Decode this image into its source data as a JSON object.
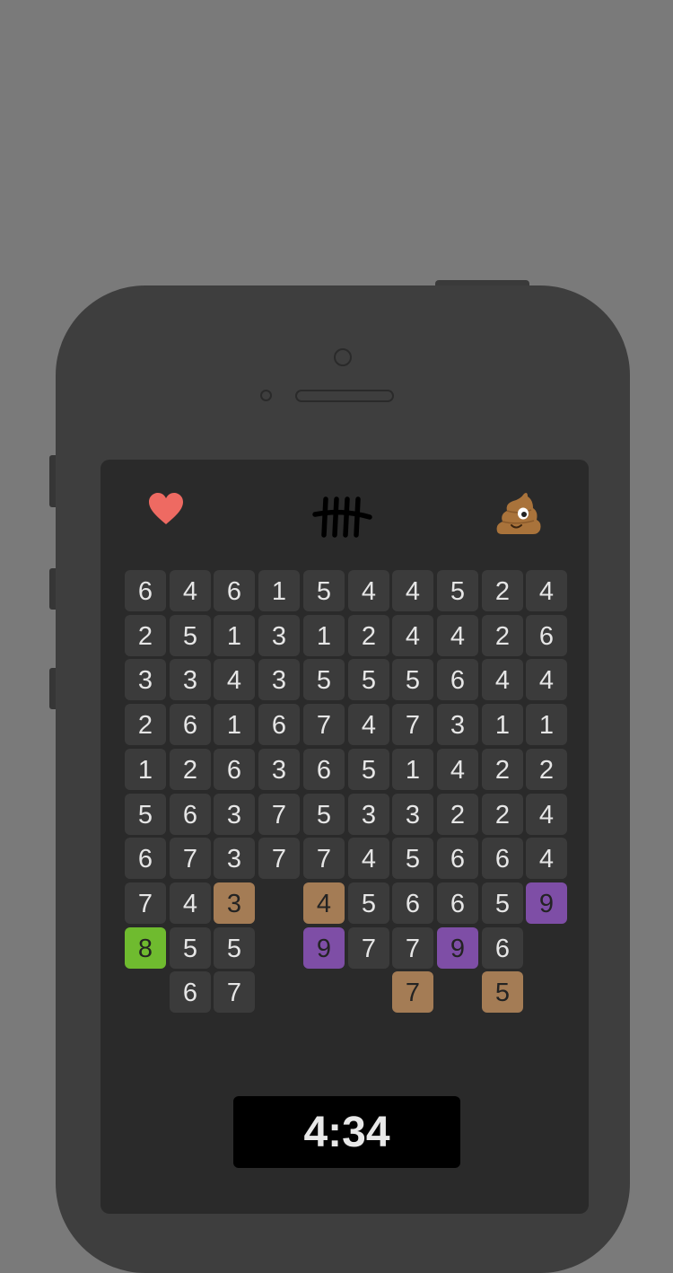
{
  "header": {
    "lives_icon": "heart-icon",
    "tally_icon": "tally-marks-icon",
    "score_tally_marks": 5,
    "poop_icon": "poop-emoji-icon"
  },
  "colors": {
    "background": "#7a7a7a",
    "phone_body": "#3e3e3e",
    "screen": "#2a2a2a",
    "tile_default": "#3b3b3b",
    "tile_tan": "#a47c55",
    "tile_purple": "#7e4ea6",
    "tile_green": "#6fbb2f",
    "heart": "#ee6a62",
    "timer_bg": "#000000"
  },
  "board": {
    "columns": 10,
    "rows": [
      [
        {
          "v": "6"
        },
        {
          "v": "4"
        },
        {
          "v": "6"
        },
        {
          "v": "1"
        },
        {
          "v": "5"
        },
        {
          "v": "4"
        },
        {
          "v": "4"
        },
        {
          "v": "5"
        },
        {
          "v": "2"
        },
        {
          "v": "4"
        }
      ],
      [
        {
          "v": "2"
        },
        {
          "v": "5"
        },
        {
          "v": "1"
        },
        {
          "v": "3"
        },
        {
          "v": "1"
        },
        {
          "v": "2"
        },
        {
          "v": "4"
        },
        {
          "v": "4"
        },
        {
          "v": "2"
        },
        {
          "v": "6"
        }
      ],
      [
        {
          "v": "3"
        },
        {
          "v": "3"
        },
        {
          "v": "4"
        },
        {
          "v": "3"
        },
        {
          "v": "5"
        },
        {
          "v": "5"
        },
        {
          "v": "5"
        },
        {
          "v": "6"
        },
        {
          "v": "4"
        },
        {
          "v": "4"
        }
      ],
      [
        {
          "v": "2"
        },
        {
          "v": "6"
        },
        {
          "v": "1"
        },
        {
          "v": "6"
        },
        {
          "v": "7"
        },
        {
          "v": "4"
        },
        {
          "v": "7"
        },
        {
          "v": "3"
        },
        {
          "v": "1"
        },
        {
          "v": "1"
        }
      ],
      [
        {
          "v": "1"
        },
        {
          "v": "2"
        },
        {
          "v": "6"
        },
        {
          "v": "3"
        },
        {
          "v": "6"
        },
        {
          "v": "5"
        },
        {
          "v": "1"
        },
        {
          "v": "4"
        },
        {
          "v": "2"
        },
        {
          "v": "2"
        }
      ],
      [
        {
          "v": "5"
        },
        {
          "v": "6"
        },
        {
          "v": "3"
        },
        {
          "v": "7"
        },
        {
          "v": "5"
        },
        {
          "v": "3"
        },
        {
          "v": "3"
        },
        {
          "v": "2"
        },
        {
          "v": "2"
        },
        {
          "v": "4"
        }
      ],
      [
        {
          "v": "6"
        },
        {
          "v": "7"
        },
        {
          "v": "3"
        },
        {
          "v": "7"
        },
        {
          "v": "7"
        },
        {
          "v": "4"
        },
        {
          "v": "5"
        },
        {
          "v": "6"
        },
        {
          "v": "6"
        },
        {
          "v": "4"
        }
      ],
      [
        {
          "v": "7"
        },
        {
          "v": "4"
        },
        {
          "v": "3",
          "c": "tan"
        },
        null,
        {
          "v": "4",
          "c": "tan"
        },
        {
          "v": "5"
        },
        {
          "v": "6"
        },
        {
          "v": "6"
        },
        {
          "v": "5"
        },
        {
          "v": "9",
          "c": "purple"
        }
      ],
      [
        {
          "v": "8",
          "c": "green"
        },
        {
          "v": "5"
        },
        {
          "v": "5"
        },
        null,
        {
          "v": "9",
          "c": "purple"
        },
        {
          "v": "7"
        },
        {
          "v": "7"
        },
        {
          "v": "9",
          "c": "purple"
        },
        {
          "v": "6"
        },
        null
      ],
      [
        null,
        {
          "v": "6"
        },
        {
          "v": "7"
        },
        null,
        null,
        null,
        {
          "v": "7",
          "c": "tan"
        },
        null,
        {
          "v": "5",
          "c": "tan"
        },
        null
      ]
    ]
  },
  "timer": {
    "value": "4:34"
  }
}
